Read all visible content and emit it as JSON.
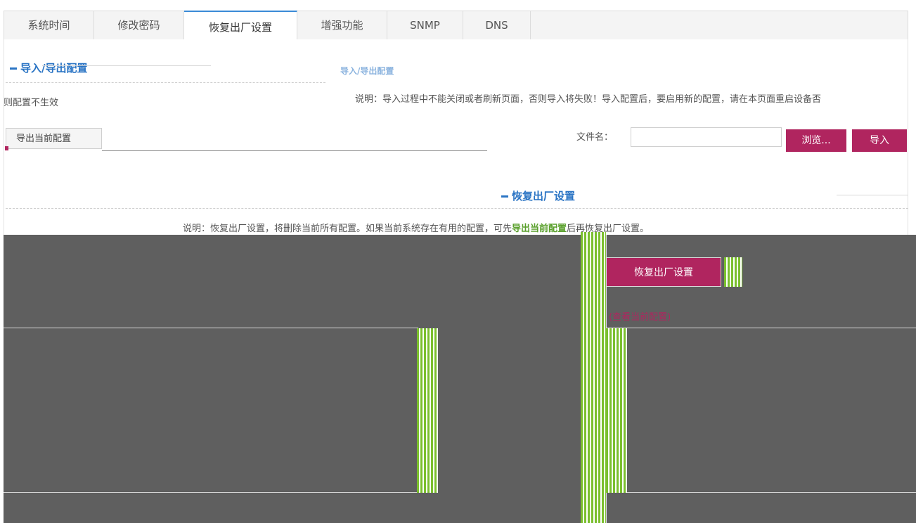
{
  "tabs": [
    {
      "label": "系统时间",
      "active": false
    },
    {
      "label": "修改密码",
      "active": false
    },
    {
      "label": "恢复出厂设置",
      "active": true
    },
    {
      "label": "增强功能",
      "active": false
    },
    {
      "label": "SNMP",
      "active": false
    },
    {
      "label": "DNS",
      "active": false
    }
  ],
  "import_export": {
    "title": "导入/导出配置",
    "note_left": "则配置不生效",
    "note_right": "说明：导入过程中不能关闭或者刷新页面，否则导入将失败！导入配置后，要启用新的配置，请在本页面重启设备否",
    "export_button": "导出当前配置",
    "file_label": "文件名：",
    "file_value": "",
    "browse_button": "浏览...",
    "import_button": "导入"
  },
  "factory_reset": {
    "title": "恢复出厂设置",
    "desc_prefix": "说明：恢复出厂设置，将删除当前所有配置。如果当前系统存在有用的配置，可先",
    "desc_link": "导出当前配置",
    "desc_suffix": "后再恢复出厂设置。",
    "reset_button": "恢复出厂设置",
    "view_config_link": "(查看当前配置)"
  },
  "colors": {
    "accent_blue": "#2a74c4",
    "button_pink": "#b0255f",
    "highlight_green": "#5aa02c",
    "overlay_dark": "#5f5f5f"
  }
}
